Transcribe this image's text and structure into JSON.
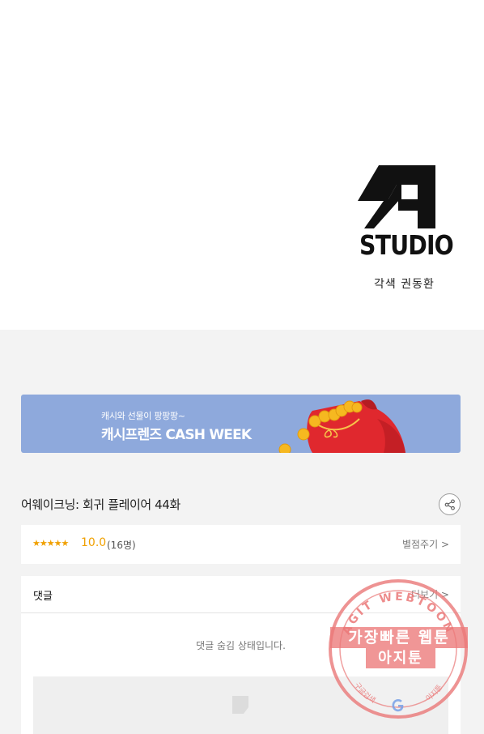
{
  "comic": {
    "studio_name": "STUDIO",
    "credit": "각색 권동환"
  },
  "banner": {
    "subtitle": "캐시와 선물이 팡팡팡~",
    "title": "캐시프렌즈 CASH WEEK"
  },
  "episode": {
    "title": "어웨이크닝: 회귀 플레이어 44화"
  },
  "rating": {
    "stars": "★★★★★",
    "score": "10.0",
    "count": "(16명)",
    "rate_link": "별점주기 >"
  },
  "comments": {
    "label": "댓글",
    "more": "더보기 >",
    "hidden_notice": "댓글 숨김 상태입니다."
  },
  "watermark": {
    "arc_text": "AGIT WEBTOON",
    "line1": "가장빠른 웹툰",
    "line2": "아지툰",
    "bottom_left": "구글검색",
    "bottom_right": "아지툰"
  }
}
